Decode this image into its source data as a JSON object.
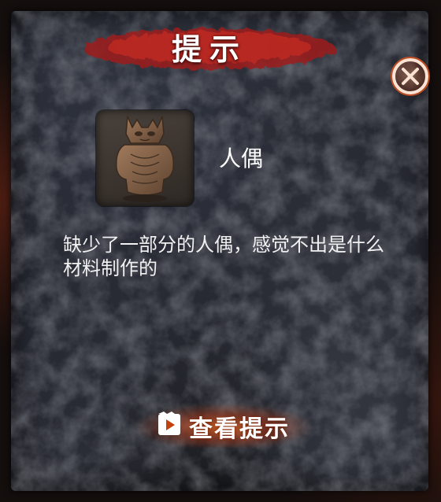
{
  "dialog": {
    "title": "提示",
    "close_icon": "close-x-icon",
    "accent_color": "#d9471c"
  },
  "item": {
    "name": "人偶",
    "image_icon": "clay-figurine-image",
    "description": "缺少了一部分的人偶，感觉不出是什么材料制作的"
  },
  "hint_button": {
    "icon": "video-play-icon",
    "label": "查看提示"
  }
}
